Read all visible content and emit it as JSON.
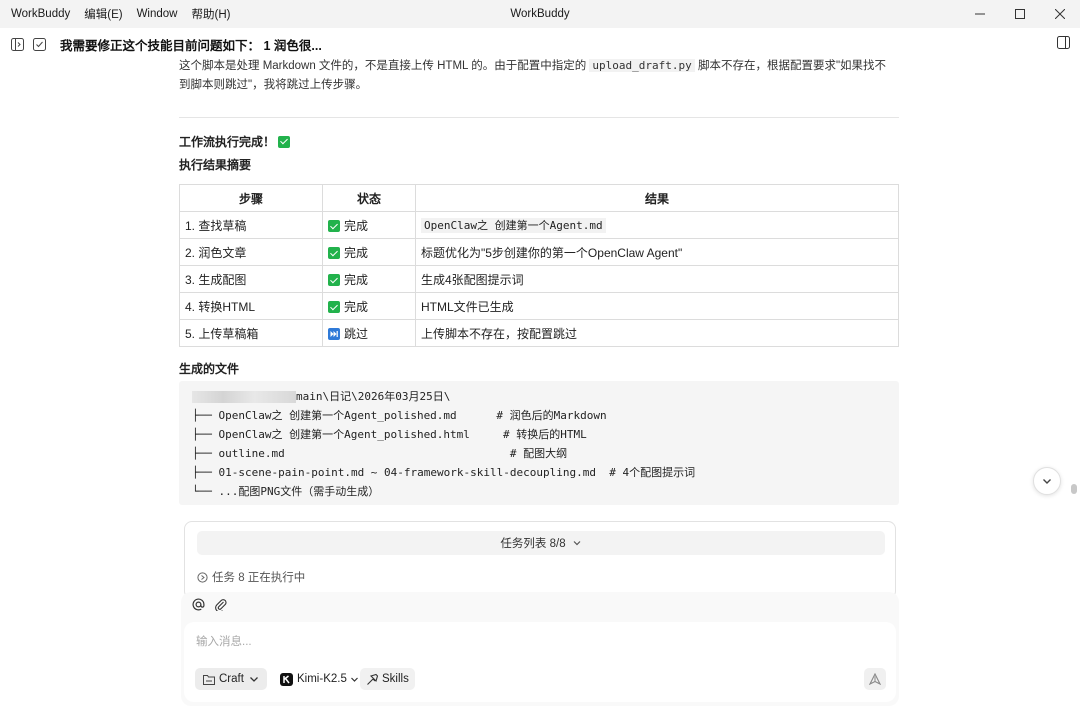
{
  "titlebar": {
    "menu": [
      "WorkBuddy",
      "编辑(E)",
      "Window",
      "帮助(H)"
    ],
    "title": "WorkBuddy"
  },
  "header": {
    "title": "我需要修正这个技能目前问题如下：  1 润色很..."
  },
  "intro": {
    "line1_a": "这个脚本是处理 Markdown 文件的，不是直接上传 HTML 的。由于配置中指定的 ",
    "line1_code": "upload_draft.py",
    "line1_b": " 脚本不存在，根据配置要求\"如果找不",
    "line2": "到脚本则跳过\"，我将跳过上传步骤。"
  },
  "workflow": {
    "done_label": "工作流执行完成！",
    "summary_title": "执行结果摘要"
  },
  "table": {
    "headers": [
      "步骤",
      "状态",
      "结果"
    ],
    "rows": [
      {
        "step": "1. 查找草稿",
        "status": "完成",
        "result": "OpenClaw之 创建第一个Agent.md"
      },
      {
        "step": "2. 润色文章",
        "status": "完成",
        "result": "标题优化为\"5步创建你的第一个OpenClaw Agent\""
      },
      {
        "step": "3. 生成配图",
        "status": "完成",
        "result": "生成4张配图提示词"
      },
      {
        "step": "4. 转换HTML",
        "status": "完成",
        "result": "HTML文件已生成"
      },
      {
        "step": "5. 上传草稿箱",
        "status": "跳过",
        "result": "上传脚本不存在，按配置跳过"
      }
    ]
  },
  "files": {
    "title": "生成的文件",
    "path_suffix": "main\\日记\\2026年03月25日\\",
    "lines": [
      "├── OpenClaw之 创建第一个Agent_polished.md      # 润色后的Markdown",
      "├── OpenClaw之 创建第一个Agent_polished.html     # 转换后的HTML",
      "├── outline.md                                  # 配图大纲",
      "├── 01-scene-pain-point.md ~ 04-framework-skill-decoupling.md  # 4个配图提示词",
      "└── ...配图PNG文件（需手动生成）"
    ]
  },
  "tasks": {
    "list_label": "任务列表 8/8",
    "status_label": "任务 8 正在执行中"
  },
  "composer": {
    "placeholder": "输入消息...",
    "mode_label": "Craft",
    "model_label": "Kimi-K2.5",
    "skills_label": "Skills"
  },
  "colors": {
    "check_green": "#22b24c",
    "skip_blue": "#2f7ad8"
  }
}
